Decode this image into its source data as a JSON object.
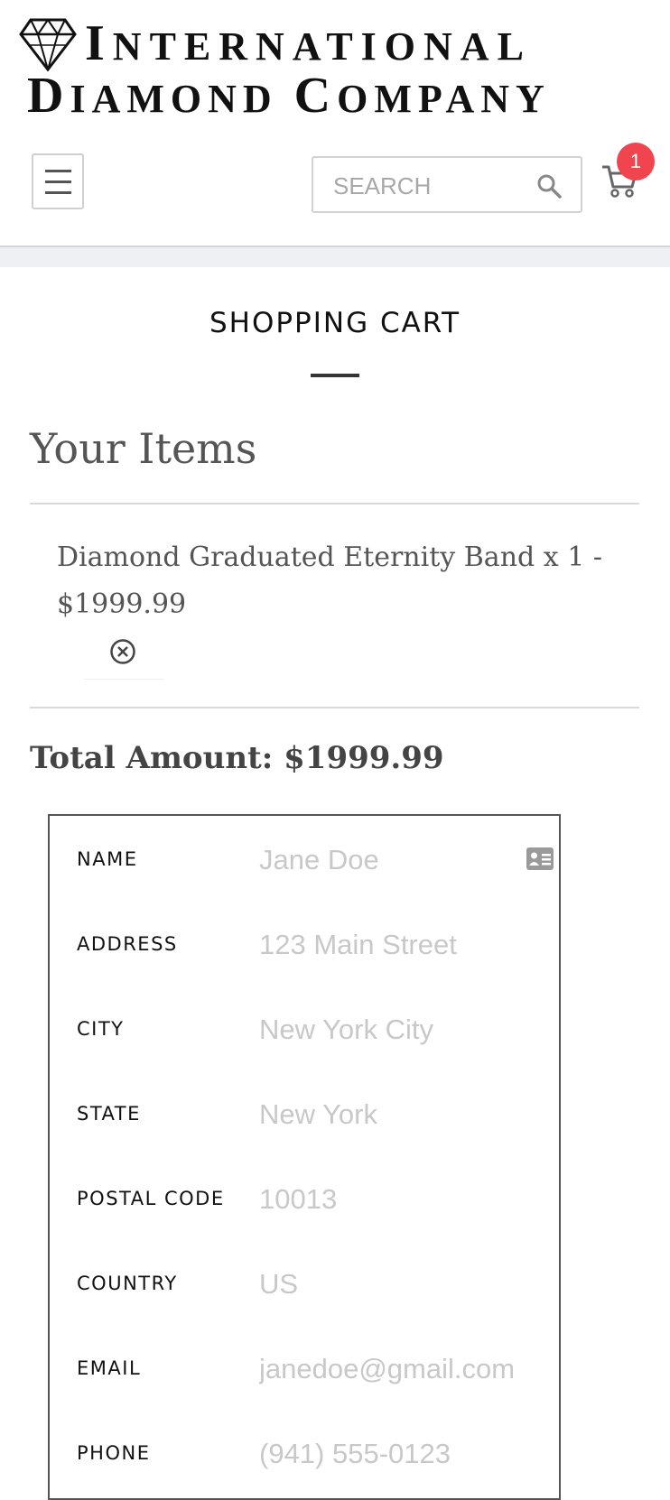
{
  "brand": {
    "line1_initial": "I",
    "line1_rest": "NTERNATIONAL",
    "line2_word1_initial": "D",
    "line2_word1_rest": "IAMOND",
    "line2_word2_initial": "C",
    "line2_word2_rest": "OMPANY"
  },
  "header": {
    "search_placeholder": "SEARCH",
    "cart_count": "1"
  },
  "page": {
    "title": "SHOPPING CART",
    "items_heading": "Your Items",
    "cart_items": [
      {
        "text": "Diamond Graduated Eternity Band x 1 - $1999.99"
      }
    ],
    "total": "Total Amount: $1999.99"
  },
  "form": {
    "fields": [
      {
        "label": "NAME",
        "placeholder": "Jane Doe"
      },
      {
        "label": "ADDRESS",
        "placeholder": "123 Main Street"
      },
      {
        "label": "CITY",
        "placeholder": "New York City"
      },
      {
        "label": "STATE",
        "placeholder": "New York"
      },
      {
        "label": "POSTAL CODE",
        "placeholder": "10013"
      },
      {
        "label": "COUNTRY",
        "placeholder": "US"
      },
      {
        "label": "EMAIL",
        "placeholder": "janedoe@gmail.com"
      },
      {
        "label": "PHONE",
        "placeholder": "(941) 555-0123"
      }
    ]
  },
  "colors": {
    "badge": "#f0454e",
    "divider_band": "#eff0f4"
  },
  "icons": [
    "diamond-logo-icon",
    "menu-icon",
    "search-icon",
    "cart-icon",
    "remove-icon",
    "contact-card-icon"
  ]
}
